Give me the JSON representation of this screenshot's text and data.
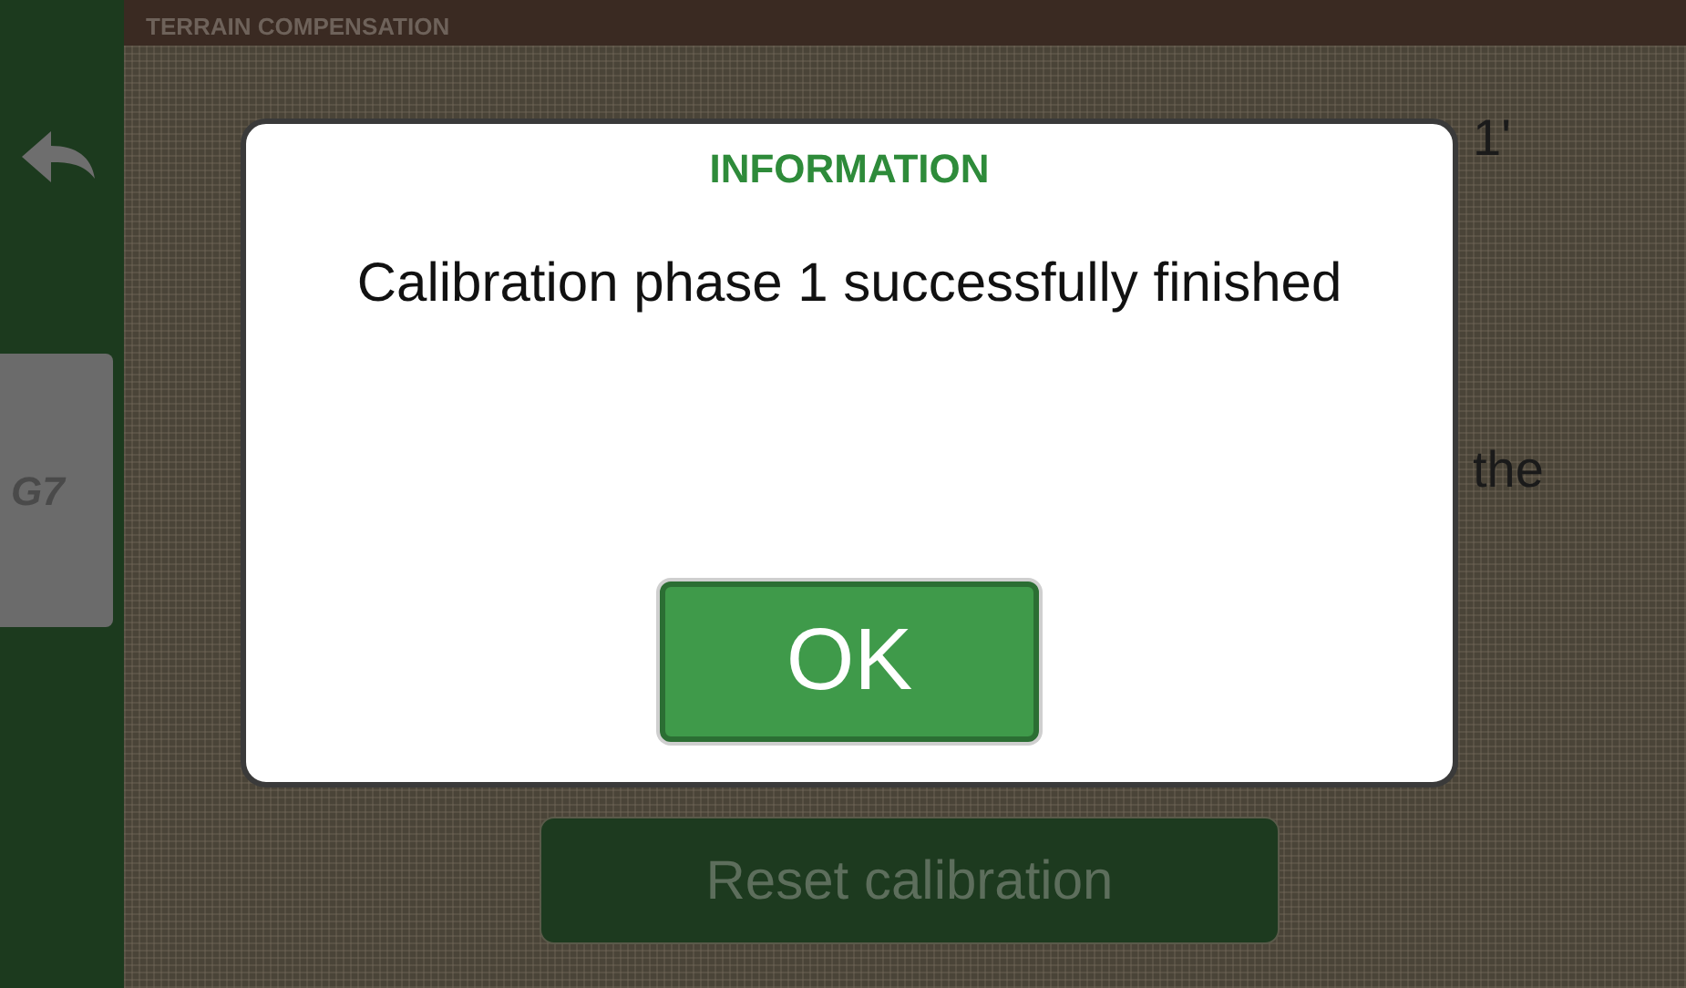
{
  "header": {
    "title": "TERRAIN COMPENSATION"
  },
  "sidebar": {
    "logo": "G7"
  },
  "background_texts": [
    "1'",
    "the"
  ],
  "reset_button": {
    "label": "Reset calibration",
    "disabled": true
  },
  "dialog": {
    "title": "INFORMATION",
    "message": "Calibration phase 1 successfully finished",
    "button": "OK"
  }
}
